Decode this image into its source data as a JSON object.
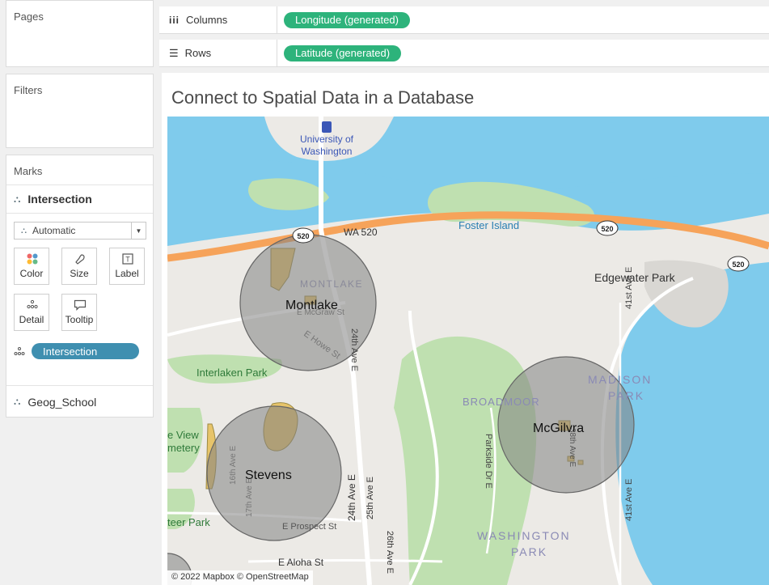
{
  "left": {
    "pages_title": "Pages",
    "filters_title": "Filters",
    "marks": {
      "title": "Marks",
      "layer_name": "Intersection",
      "mark_type": "Automatic",
      "buttons": [
        {
          "label": "Color",
          "icon": "color-dots-icon"
        },
        {
          "label": "Size",
          "icon": "size-icon"
        },
        {
          "label": "Label",
          "icon": "label-icon"
        },
        {
          "label": "Detail",
          "icon": "detail-dots-icon"
        },
        {
          "label": "Tooltip",
          "icon": "tooltip-icon"
        }
      ],
      "detail_pill": "Intersection",
      "second_layer": "Geog_School"
    }
  },
  "shelves": {
    "columns_label": "Columns",
    "columns_pill": "Longitude (generated)",
    "rows_label": "Rows",
    "rows_pill": "Latitude (generated)"
  },
  "view": {
    "title": "Connect to Spatial Data in a Database"
  },
  "map": {
    "labels": {
      "uw": "University of Washington",
      "wa520": "WA 520",
      "foster_island": "Foster Island",
      "edgewater": "Edgewater Park",
      "montlake_area": "MONTLAKE",
      "montlake": "Montlake",
      "e_mcgraw": "E McGraw St",
      "e_howe": "E Howe St",
      "ave24": "24th Ave E",
      "interlaken": "Interlaken Park",
      "madison": "MADISON",
      "park": "PARK",
      "broadmoor": "BROADMOOR",
      "mcgilvra": "McGilvra",
      "parkside": "Parkside Dr E",
      "ave38": "38th Ave E",
      "ave41a": "41st Ave E",
      "ave41b": "41st Ave E",
      "view": "e View",
      "cemetery": "metery",
      "stevens": "Stevens",
      "ave16": "16th Ave E",
      "ave17": "17th Ave E",
      "ave24b": "24th Ave E",
      "ave25": "25th Ave E",
      "prospect": "E Prospect St",
      "peer_park": "teer Park",
      "washington": "WASHINGTON",
      "park2": "PARK",
      "ave26": "26th Ave E",
      "aloha": "E Aloha St",
      "shield_520": "520",
      "attribution": "© 2022 Mapbox © OpenStreetMap"
    },
    "colors": {
      "water": "#7fcbec",
      "land": "#eceae6",
      "park": "#bfe0b0",
      "highway": "#f6a35a",
      "circle": "#8c8c8c",
      "school": "#e7c46a",
      "pill_green": "#2db37b",
      "pill_blue": "#3f8fb0"
    }
  }
}
